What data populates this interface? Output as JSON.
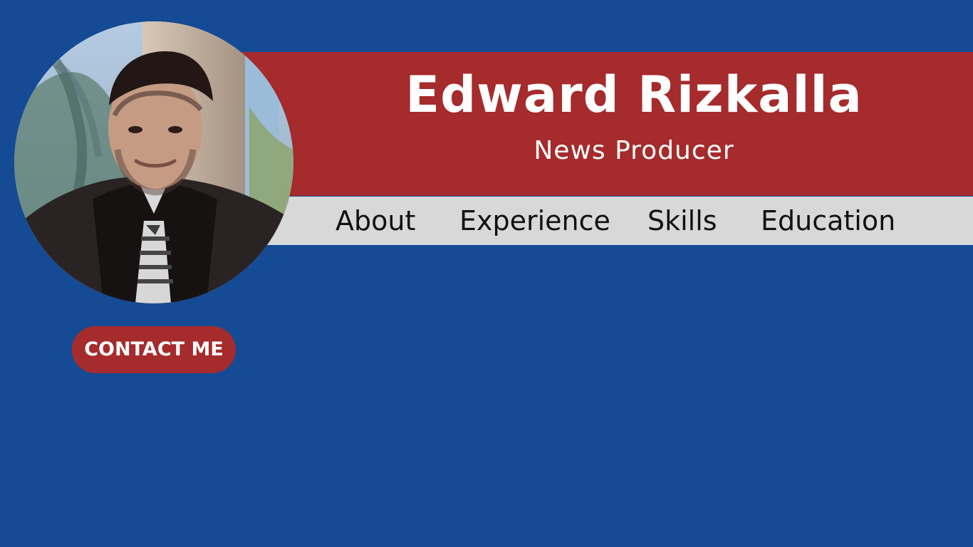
{
  "profile": {
    "name": "Edward Rizkalla",
    "title": "News Producer"
  },
  "nav": {
    "items": [
      {
        "label": "About"
      },
      {
        "label": "Experience"
      },
      {
        "label": "Skills"
      },
      {
        "label": "Education"
      }
    ]
  },
  "actions": {
    "contact_label": "CONTACT ME"
  },
  "colors": {
    "background": "#154b95",
    "accent_red": "#a52b2c",
    "nav_bar": "#d8d8d8",
    "text_light": "#ffffff",
    "text_dark": "#111111"
  }
}
